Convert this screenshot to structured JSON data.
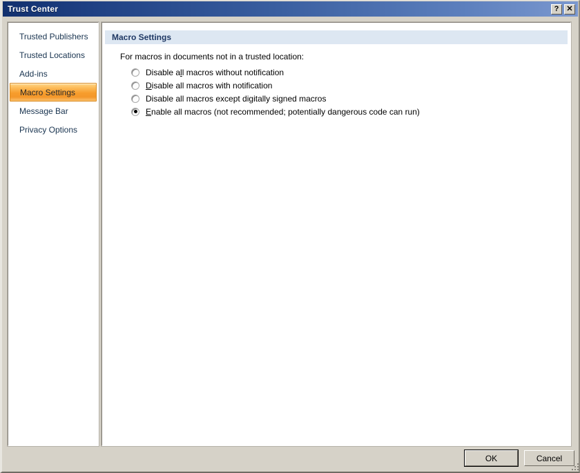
{
  "window": {
    "title": "Trust Center",
    "help_button": "?",
    "close_button": "✕"
  },
  "sidebar": {
    "items": [
      {
        "label": "Trusted Publishers",
        "selected": false
      },
      {
        "label": "Trusted Locations",
        "selected": false
      },
      {
        "label": "Add-ins",
        "selected": false
      },
      {
        "label": "Macro Settings",
        "selected": true
      },
      {
        "label": "Message Bar",
        "selected": false
      },
      {
        "label": "Privacy Options",
        "selected": false
      }
    ]
  },
  "main": {
    "section_title": "Macro Settings",
    "intro": "For macros in documents not in a trusted location:",
    "options": [
      {
        "label": "Disable all macros without notification",
        "before": "Disable a",
        "accel": "l",
        "after": "l macros without notification",
        "selected": false
      },
      {
        "label": "Disable all macros with notification",
        "before": "",
        "accel": "D",
        "after": "isable all macros with notification",
        "selected": false
      },
      {
        "label": "Disable all macros except digitally signed macros",
        "before": "Disable all macros except di",
        "accel": "g",
        "after": "itally signed macros",
        "selected": false
      },
      {
        "label": "Enable all macros (not recommended; potentially dangerous code can run)",
        "before": "",
        "accel": "E",
        "after": "nable all macros (not recommended; potentially dangerous code can run)",
        "selected": true
      }
    ],
    "selected_option_index": 3
  },
  "footer": {
    "ok_label": "OK",
    "cancel_label": "Cancel"
  },
  "colors": {
    "titlebar_start": "#12306e",
    "titlebar_end": "#7b98cf",
    "selection_orange": "#f79d2d",
    "section_header_bg": "#dde7f2",
    "section_header_text": "#1f3864",
    "dialog_bg": "#d6d2c8"
  }
}
